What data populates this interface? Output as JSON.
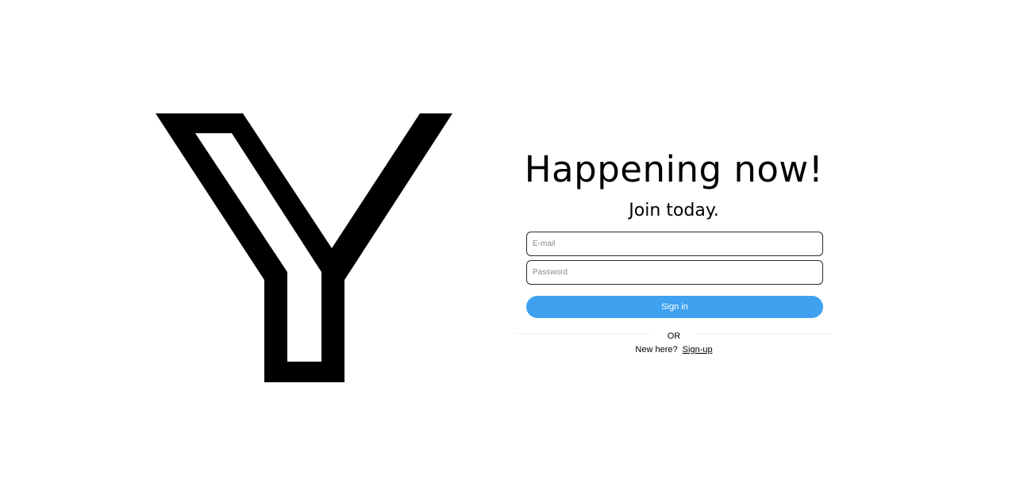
{
  "logo": {
    "name": "y-logo-icon",
    "color": "#000000"
  },
  "hero": {
    "title": "Happening now!",
    "subtitle": "Join today."
  },
  "form": {
    "email_placeholder": "E-mail",
    "email_value": "",
    "password_placeholder": "Password",
    "password_value": "",
    "signin_label": "Sign in",
    "signin_color": "#3fa1f0"
  },
  "divider": {
    "label": "OR"
  },
  "signup": {
    "prompt": "New here?",
    "link_label": "Sign-up"
  }
}
